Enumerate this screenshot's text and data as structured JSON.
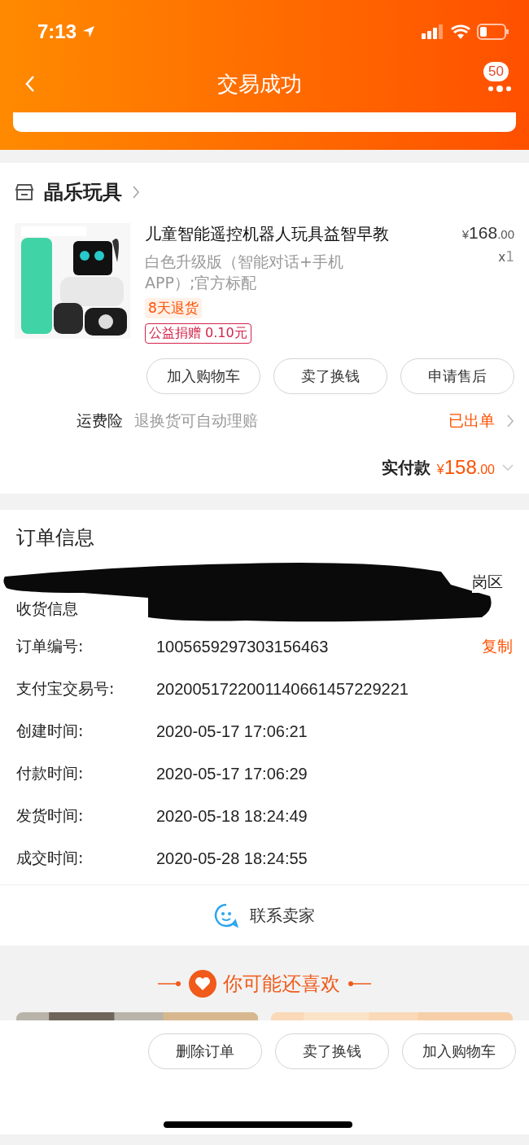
{
  "status_bar": {
    "time": "7:13"
  },
  "nav": {
    "title": "交易成功",
    "badge": "50"
  },
  "store": {
    "name": "晶乐玩具"
  },
  "product": {
    "title": "儿童智能遥控机器人玩具益智早教",
    "spec": "白色升级版（智能对话+手机APP）;官方标配",
    "price_symbol": "¥",
    "price": "168",
    "price_decimal": ".00",
    "quantity_prefix": "x",
    "quantity": "1",
    "tags": [
      {
        "text": "8天退货",
        "kind": "return"
      },
      {
        "text": "公益捐赠 0.10元",
        "kind": "charity"
      }
    ]
  },
  "item_buttons": [
    "加入购物车",
    "卖了换钱",
    "申请售后"
  ],
  "insurance": {
    "label": "运费险",
    "desc": "退换货可自动理赔",
    "status": "已出单"
  },
  "total": {
    "label": "实付款",
    "symbol": "¥",
    "amount": "158",
    "decimal": ".00"
  },
  "order_info": {
    "title": "订单信息",
    "address_label": "收货信息",
    "address_tail": "岗区",
    "rows": [
      {
        "label": "订单编号:",
        "value": "1005659297303156463",
        "action": "复制"
      },
      {
        "label": "支付宝交易号:",
        "value": "2020051722001140661457229221"
      },
      {
        "label": "创建时间:",
        "value": "2020-05-17 17:06:21"
      },
      {
        "label": "付款时间:",
        "value": "2020-05-17 17:06:29"
      },
      {
        "label": "发货时间:",
        "value": "2020-05-18 18:24:49"
      },
      {
        "label": "成交时间:",
        "value": "2020-05-28 18:24:55"
      }
    ]
  },
  "contact": {
    "label": "联系卖家"
  },
  "recommend": {
    "title": "你可能还喜欢"
  },
  "bottom_buttons": [
    "删除订单",
    "卖了换钱",
    "加入购物车"
  ]
}
